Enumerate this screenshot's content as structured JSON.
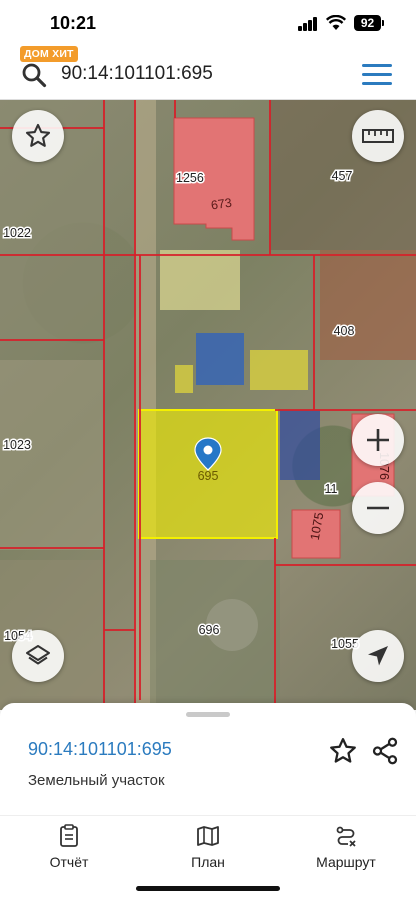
{
  "status_bar": {
    "time": "10:21",
    "battery": "92"
  },
  "brand": {
    "badge": "ДОМ ХИТ"
  },
  "search": {
    "value": "90:14:101101:695",
    "placeholder": ""
  },
  "map": {
    "parcel_labels": [
      "1256",
      "673",
      "457",
      "1022",
      "408",
      "1023",
      "695",
      "11",
      "1075",
      "1076",
      "696",
      "1054",
      "1055"
    ],
    "colors": {
      "boundary": "#d6202a",
      "selected_fill": "#f4f000",
      "building_fill": "#e27474",
      "pin": "#2577c7"
    }
  },
  "sheet": {
    "cadastral_number": "90:14:101101:695",
    "object_type": "Земельный участок"
  },
  "nav": {
    "report": "Отчёт",
    "plan": "План",
    "route": "Маршрут"
  },
  "accent_color": "#2b7bbf"
}
